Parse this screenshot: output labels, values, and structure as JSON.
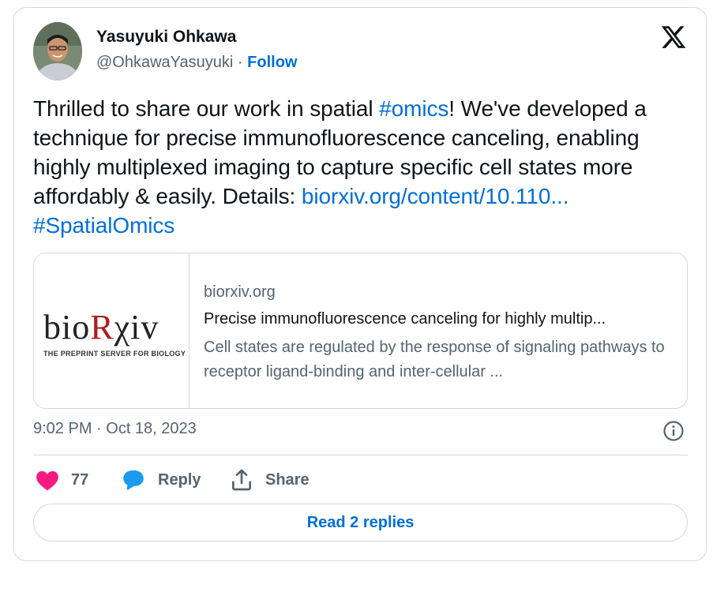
{
  "author": {
    "name": "Yasuyuki Ohkawa",
    "handle": "@OhkawaYasuyuki",
    "separator": "·",
    "follow_label": "Follow"
  },
  "tweet": {
    "text_1": "Thrilled to share our work in spatial ",
    "hashtag_1": "#omics",
    "text_2": "! We've developed a  technique for precise immunofluorescence canceling, enabling highly multiplexed imaging to capture specific cell states more affordably  & easily. Details: ",
    "link": "biorxiv.org/content/10.110...",
    "text_3": " ",
    "hashtag_2": "#SpatialOmics"
  },
  "link_card": {
    "brand_prefix": "bio",
    "brand_r": "R",
    "brand_suffix": "χiv",
    "brand_tagline": "THE PREPRINT SERVER FOR BIOLOGY",
    "domain": "biorxiv.org",
    "title": "Precise immunofluorescence canceling for highly multip...",
    "description": "Cell states are regulated by the response of signaling pathways to receptor ligand-binding and inter-cellular ..."
  },
  "timestamp": "9:02 PM · Oct 18, 2023",
  "actions": {
    "like_count": "77",
    "reply_label": "Reply",
    "share_label": "Share"
  },
  "read_replies_label": "Read 2 replies",
  "colors": {
    "link": "#006fd6",
    "like": "#f91880",
    "reply_icon": "#1d9bf0",
    "muted": "#536471",
    "border": "#cfd9de"
  },
  "icons": [
    "avatar-photo",
    "x-logo-icon",
    "info-icon",
    "heart-icon",
    "reply-bubble-icon",
    "share-icon"
  ]
}
